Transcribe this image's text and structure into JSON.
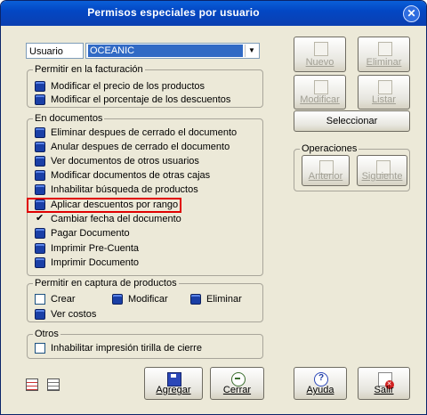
{
  "window": {
    "title": "Permisos especiales por usuario",
    "close_glyph": "✕"
  },
  "user": {
    "label": "Usuario",
    "selected": "OCEANIC",
    "arrow_glyph": "▼"
  },
  "facturacion": {
    "title": "Permitir en la facturación",
    "items": [
      {
        "label": "Modificar el precio de los productos",
        "state": "blue"
      },
      {
        "label": "Modificar el porcentaje de los descuentos",
        "state": "blue"
      }
    ]
  },
  "documentos": {
    "title": "En documentos",
    "items": [
      {
        "label": "Eliminar despues de cerrado el documento",
        "state": "blue"
      },
      {
        "label": "Anular despues de cerrado el documento",
        "state": "blue"
      },
      {
        "label": "Ver documentos de otros usuarios",
        "state": "blue"
      },
      {
        "label": "Modificar documentos de otras cajas",
        "state": "blue"
      },
      {
        "label": "Inhabilitar búsqueda de productos",
        "state": "blue"
      },
      {
        "label": "Aplicar descuentos por rango",
        "state": "blue",
        "highlighted": true
      },
      {
        "label": "Cambiar fecha del documento",
        "state": "check"
      },
      {
        "label": "Pagar Documento",
        "state": "blue"
      },
      {
        "label": "Imprimir Pre-Cuenta",
        "state": "blue"
      },
      {
        "label": "Imprimir Documento",
        "state": "blue"
      }
    ]
  },
  "captura": {
    "title": "Permitir en captura de productos",
    "items": [
      {
        "label": "Crear",
        "state": "box"
      },
      {
        "label": "Modificar",
        "state": "blue"
      },
      {
        "label": "Eliminar",
        "state": "blue"
      },
      {
        "label": "Ver costos",
        "state": "blue"
      }
    ]
  },
  "otros": {
    "title": "Otros",
    "items": [
      {
        "label": "Inhabilitar impresión tirilla de cierre",
        "state": "box"
      }
    ]
  },
  "buttons": {
    "nuevo": "Nuevo",
    "eliminar": "Eliminar",
    "modificar": "Modificar",
    "listar": "Listar",
    "seleccionar": "Seleccionar",
    "agregar": "Agregar",
    "cerrar": "Cerrar",
    "ayuda": "Ayuda",
    "salir": "Salir"
  },
  "operaciones": {
    "title": "Operaciones",
    "anterior": "Anterior",
    "siguiente": "Siguiente"
  },
  "icons": {
    "help": "?"
  }
}
